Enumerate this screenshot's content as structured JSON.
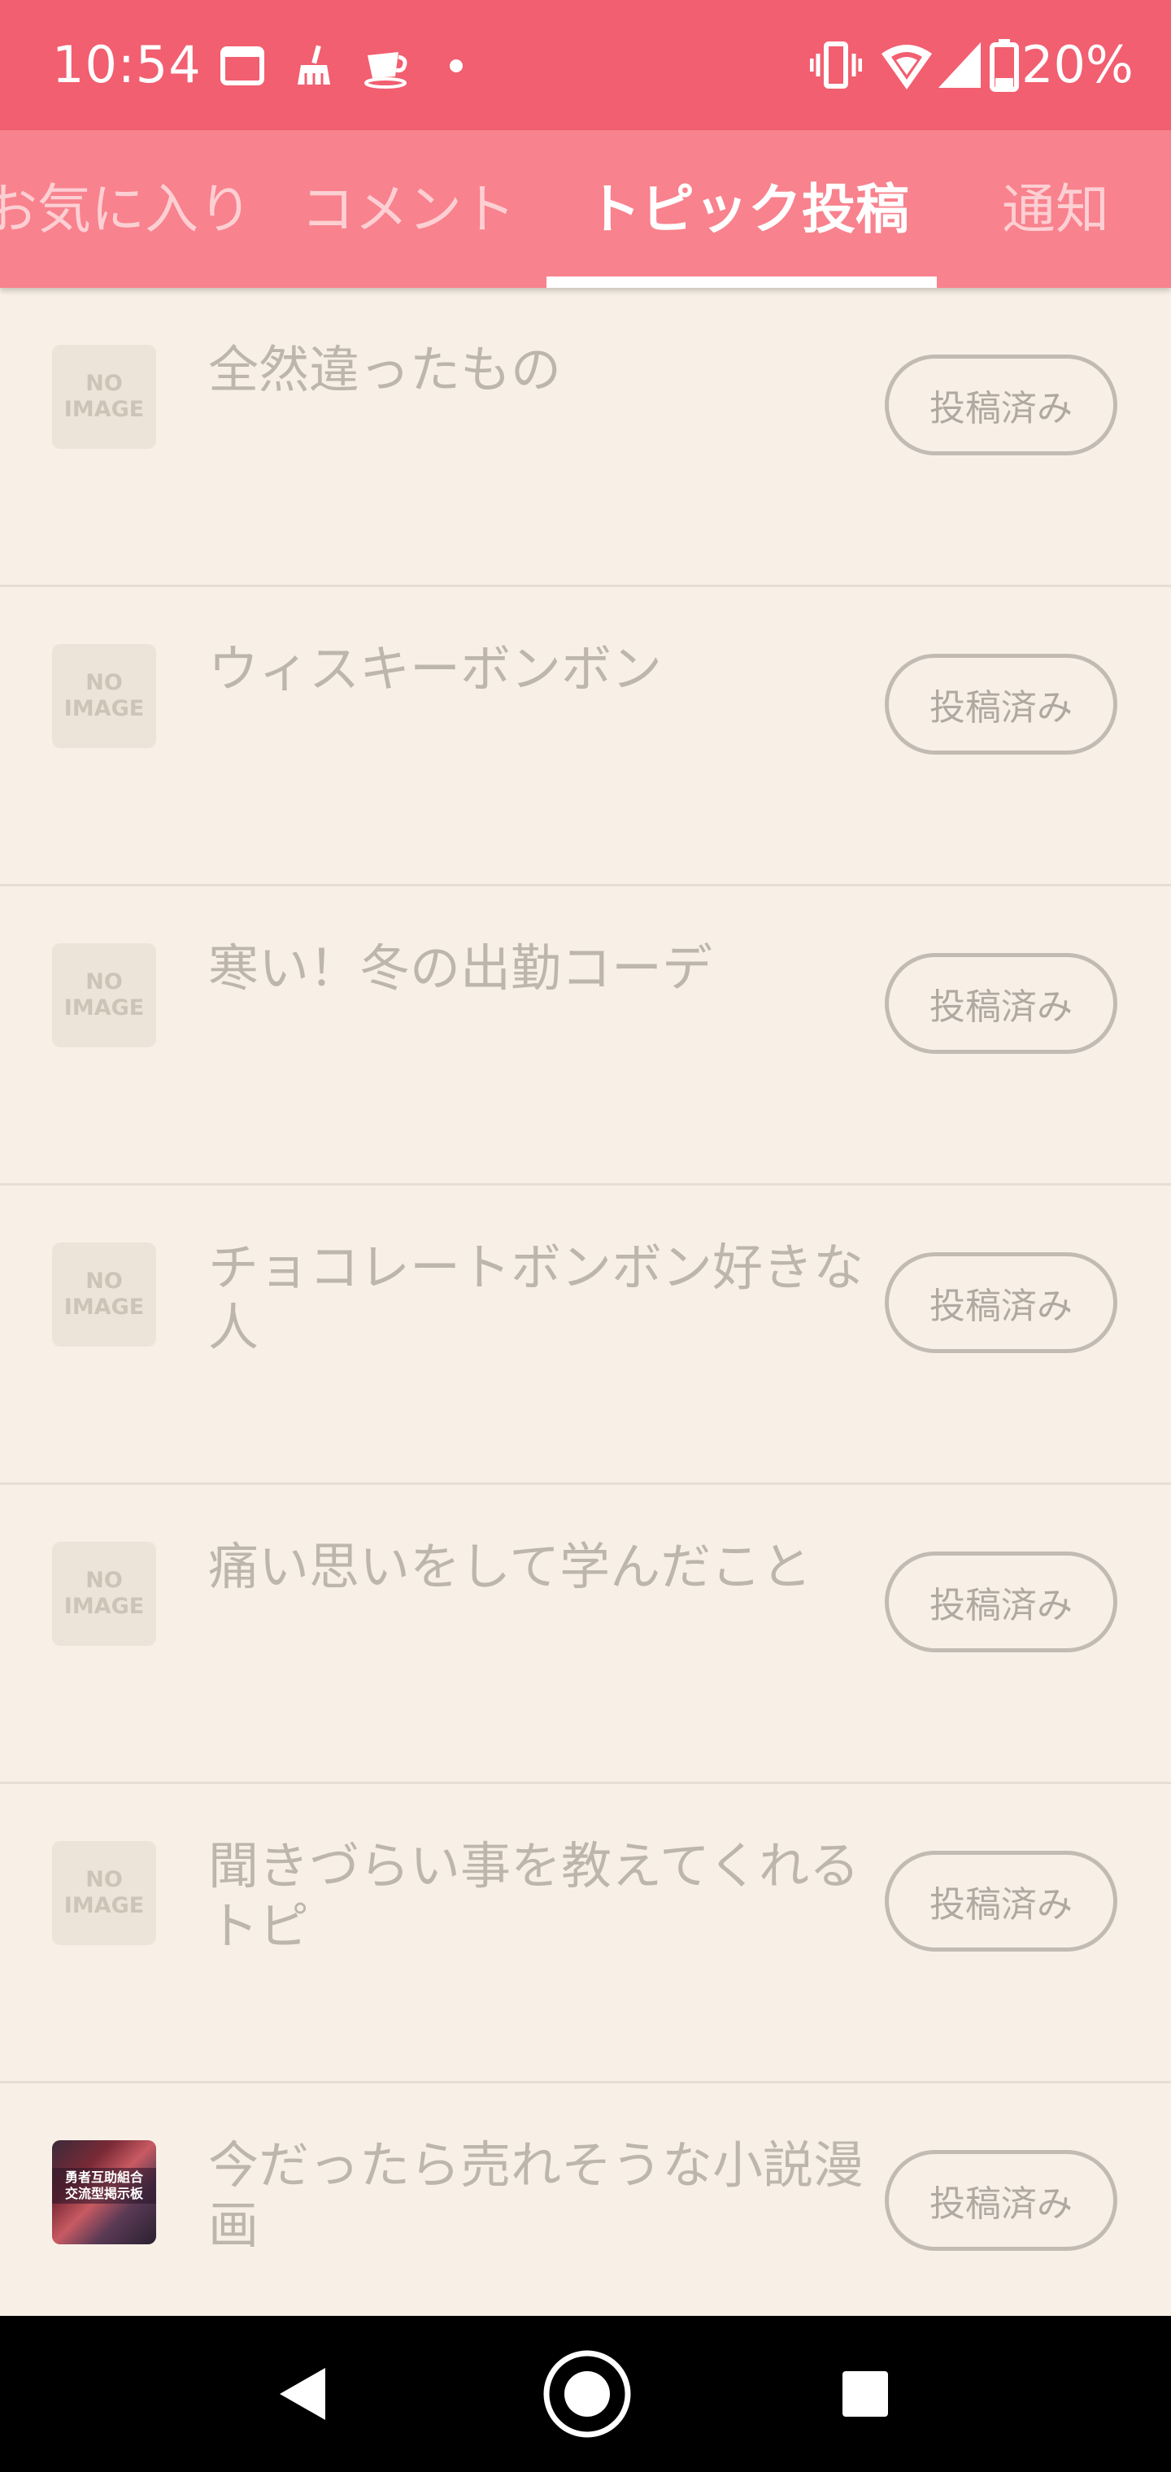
{
  "status_bar": {
    "time": "10:54",
    "battery": "20%",
    "icons_left": [
      "window-icon",
      "broom-icon",
      "teacup-icon",
      "dot-icon"
    ],
    "icons_right": [
      "vibrate-icon",
      "wifi-icon",
      "signal-icon",
      "battery-icon"
    ],
    "color": "#f15f70"
  },
  "tabs": {
    "items": [
      {
        "label": "お気に入り"
      },
      {
        "label": "コメント"
      },
      {
        "label": "トピック投稿"
      },
      {
        "label": "通知"
      }
    ],
    "active_index": 2,
    "color": "#f8828d"
  },
  "list": {
    "badge_label": "投稿済み",
    "no_image_line1": "NO",
    "no_image_line2": "IMAGE",
    "items": [
      {
        "title": "全然違ったもの",
        "thumbnail": "no-image"
      },
      {
        "title": "ウィスキーボンボン",
        "thumbnail": "no-image"
      },
      {
        "title": "寒い！冬の出勤コーデ",
        "thumbnail": "no-image"
      },
      {
        "title": "チョコレートボンボン好きな人",
        "thumbnail": "no-image"
      },
      {
        "title": "痛い思いをして学んだこと",
        "thumbnail": "no-image"
      },
      {
        "title": "聞きづらい事を教えてくれるトピ",
        "thumbnail": "no-image"
      },
      {
        "title": "今だったら売れそうな小説漫画",
        "thumbnail": "image",
        "thumbnail_caption_1": "勇者互助組合",
        "thumbnail_caption_2": "交流型掲示板"
      }
    ]
  },
  "nav_bar": {
    "buttons": [
      "back-icon",
      "home-icon",
      "recents-icon"
    ]
  }
}
